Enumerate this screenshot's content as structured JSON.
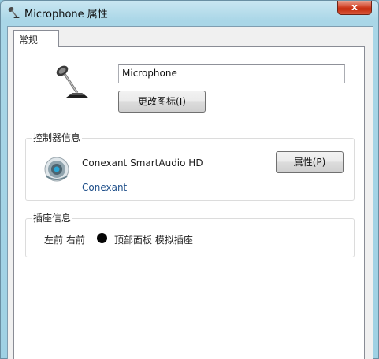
{
  "window": {
    "title": "Microphone 属性",
    "close_glyph": "x"
  },
  "tabs": [
    {
      "label": "常规",
      "active": true
    }
  ],
  "general": {
    "device_name_value": "Microphone",
    "change_icon_button": "更改图标(I)",
    "device_icon": "microphone-icon"
  },
  "controller": {
    "group_label": "控制器信息",
    "name": "Conexant SmartAudio HD",
    "vendor": "Conexant",
    "properties_button": "属性(P)",
    "icon": "speaker-icon"
  },
  "jack": {
    "group_label": "插座信息",
    "location": "左前 右前",
    "color": "#050505",
    "description": "顶部面板 模拟插座"
  },
  "colors": {
    "title_gradient_top": "#c9e6f1",
    "close_red": "#c42c0d",
    "link_blue": "#1f4f8a"
  }
}
